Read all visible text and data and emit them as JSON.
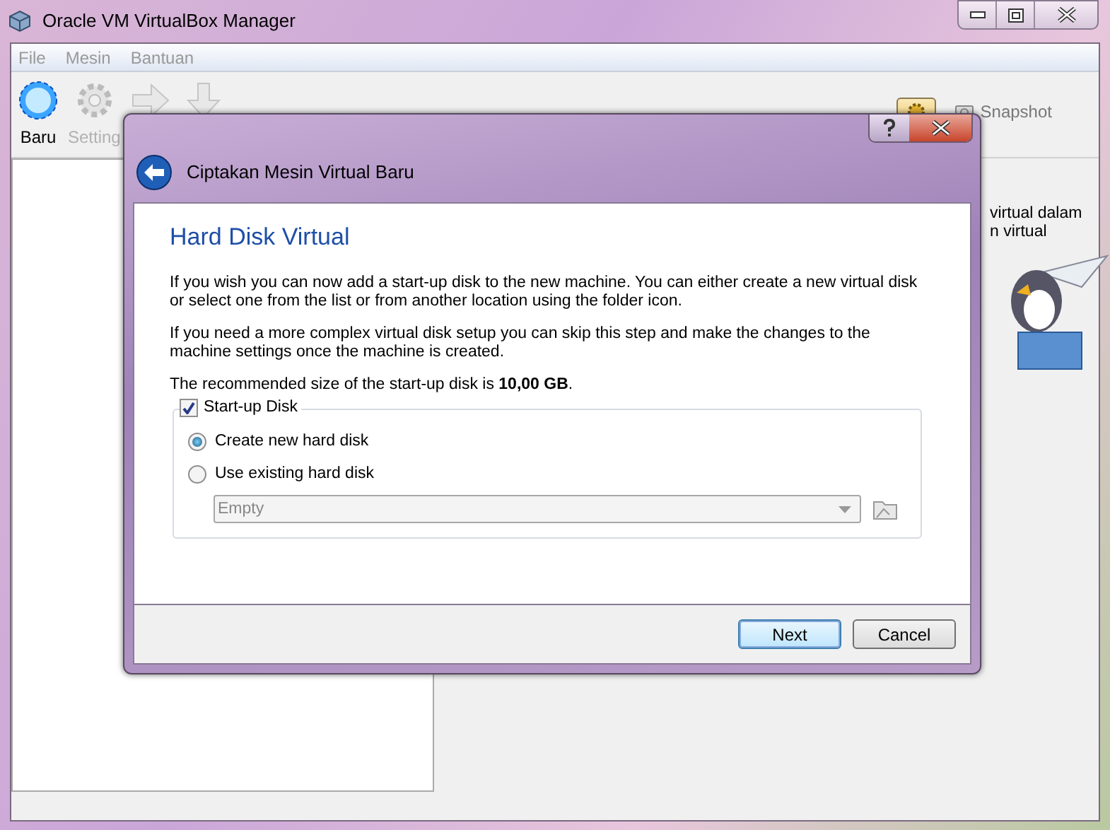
{
  "window": {
    "title": "Oracle VM VirtualBox Manager"
  },
  "menu": [
    "File",
    "Mesin",
    "Bantuan"
  ],
  "toolbar": [
    {
      "kind": "new",
      "label": "Baru",
      "disabled": false
    },
    {
      "kind": "settings",
      "label": "Setting",
      "disabled": true
    },
    {
      "kind": "start",
      "disabled": true
    },
    {
      "kind": "discard",
      "disabled": true
    }
  ],
  "view_tabs": [
    {
      "kind": "details",
      "selected": true
    },
    {
      "kind": "snapshots",
      "label": "Snapshot",
      "selected": false
    }
  ],
  "welcome_text": [
    "virtual dalam",
    "n virtual"
  ],
  "dialog": {
    "title": "Ciptakan Mesin Virtual Baru",
    "page_title": "Hard Disk Virtual",
    "paragraphs": [
      "If you wish you can now add a start-up disk to the new machine. You can either create a new virtual disk or select one from the list or from another location using the folder icon.",
      "If you need a more complex virtual disk setup you can skip this step and make the changes to the machine settings once the machine is created.",
      "The recommended size of the start-up disk is **10,00 GB**."
    ],
    "group": {
      "label": "Start-up Disk",
      "checked": true
    },
    "options": [
      {
        "label": "Create new hard disk",
        "selected": true
      },
      {
        "label": "Use existing hard disk",
        "selected": false
      }
    ],
    "disk_select": {
      "value": "Empty",
      "disabled": true
    },
    "buttons": [
      {
        "label": "Next",
        "default": true
      },
      {
        "label": "Cancel",
        "default": false
      }
    ]
  }
}
